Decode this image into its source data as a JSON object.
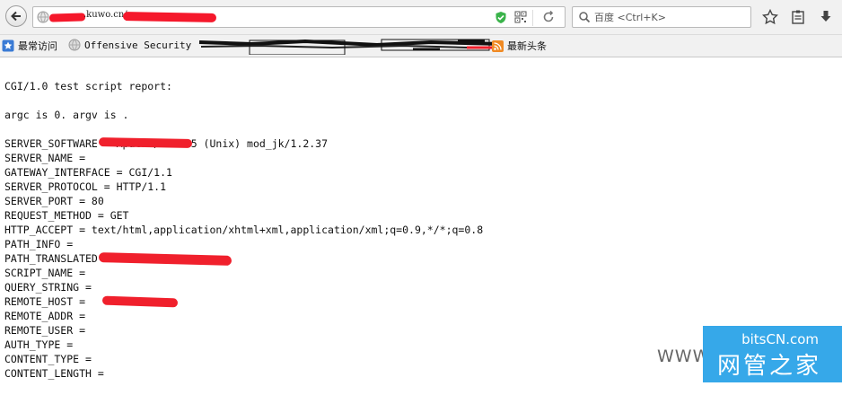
{
  "toolbar": {
    "url_visible": ".kuwo.cn/",
    "search_placeholder": "百度 <Ctrl+K>",
    "icons": [
      "back-arrow-icon",
      "globe-icon",
      "shield-icon",
      "qr-code-icon",
      "reload-icon",
      "search-icon",
      "star-icon",
      "reading-list-icon",
      "download-icon"
    ]
  },
  "bookmarks": {
    "items": [
      {
        "label": "最常访问",
        "icon": "bookmark-star-icon"
      },
      {
        "label": "Offensive Security",
        "icon": "globe-icon"
      },
      {
        "label": "最新头条",
        "icon": "rss-icon"
      }
    ]
  },
  "content": {
    "lines": [
      "CGI/1.0 test script report:",
      "",
      "argc is 0. argv is .",
      "",
      "SERVER_SOFTWARE = Apache/2.2.25 (Unix) mod_jk/1.2.37",
      "SERVER_NAME =",
      "GATEWAY_INTERFACE = CGI/1.1",
      "SERVER_PROTOCOL = HTTP/1.1",
      "SERVER_PORT = 80",
      "REQUEST_METHOD = GET",
      "HTTP_ACCEPT = text/html,application/xhtml+xml,application/xml;q=0.9,*/*;q=0.8",
      "PATH_INFO =",
      "PATH_TRANSLATED =",
      "SCRIPT_NAME =",
      "QUERY_STRING =",
      "REMOTE_HOST =",
      "REMOTE_ADDR =",
      "REMOTE_USER =",
      "AUTH_TYPE =",
      "CONTENT_TYPE =",
      "CONTENT_LENGTH ="
    ]
  },
  "watermark": {
    "www": "WWW",
    "brand": "bitsCN.com",
    "name": "网管之家"
  },
  "colors": {
    "redaction": "#f0202c",
    "logo_bg": "#36a8e9",
    "toolbar_bg": "#f1f1f1"
  }
}
